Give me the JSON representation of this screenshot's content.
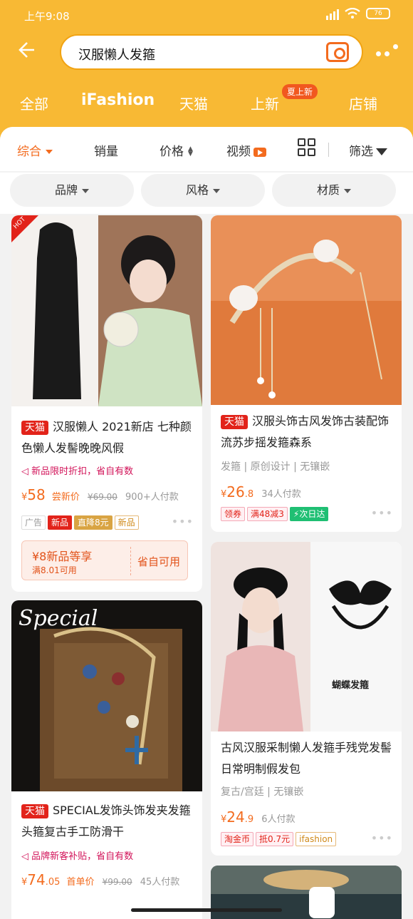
{
  "status": {
    "time": "上午9:08",
    "battery": "76"
  },
  "search": {
    "query": "汉服懒人发箍"
  },
  "tabs": {
    "all": "全部",
    "ifashion": "iFashion",
    "tmall": "天猫",
    "new": "上新",
    "new_badge": "夏上新",
    "stores": "店铺"
  },
  "sort": {
    "overall": "综合",
    "sales": "销量",
    "price": "价格",
    "video": "视频",
    "filter": "筛选"
  },
  "chips": {
    "brand": "品牌",
    "style": "风格",
    "material": "材质"
  },
  "products": [
    {
      "tmall": "天猫",
      "title": "汉服懒人 2021新店 七种颜色懒人发髻晚晚风假",
      "promo": "新品限时折扣，省自有数",
      "price": "58",
      "price_label": "尝新价",
      "old_price": "¥69.00",
      "sold": "900+人付款",
      "tags": [
        "广告",
        "新品",
        "直降8元",
        "新品"
      ],
      "coupon_amount": "¥8新品等享",
      "coupon_cond": "满8.01可用",
      "coupon_cta": "省自可用",
      "hot": "HOT"
    },
    {
      "tmall": "天猫",
      "title": "汉服头饰古风发饰古装配饰流苏步摇发箍森系",
      "attrs": "发箍 | 原创设计 | 无镶嵌",
      "price": "26",
      "price_decimal": ".8",
      "sold": "34人付款",
      "tags": [
        "领券",
        "满48减3",
        "次日达"
      ]
    },
    {
      "title": "古风汉服采制懒人发箍手残党发髻日常明制假发包",
      "attrs": "复古/宫廷 | 无镶嵌",
      "price": "24",
      "price_decimal": ".9",
      "sold": "6人付款",
      "tags": [
        "淘金币",
        "抵0.7元",
        "ifashion"
      ],
      "image_caption": "蝴蝶发箍"
    },
    {
      "tmall": "天猫",
      "title": "SPECIAL发饰头饰发夹发箍头箍复古手工防滑干",
      "promo": "品牌新客补贴，省自有数",
      "price": "74",
      "price_decimal": ".05",
      "price_label": "首单价",
      "old_price": "¥99.00",
      "sold": "45人付款",
      "logo": "Special"
    }
  ],
  "colors": {
    "header": "#f8b934",
    "accent": "#f36b1e",
    "tmall_red": "#e2231a"
  }
}
